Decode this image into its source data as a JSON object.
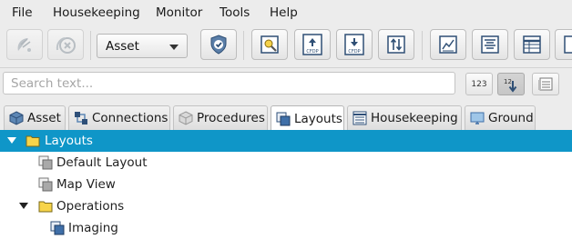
{
  "menubar": {
    "items": [
      "File",
      "Housekeeping",
      "Monitor",
      "Tools",
      "Help"
    ]
  },
  "toolbar": {
    "combo_value": "Asset",
    "buttons": [
      {
        "icon": "satellite-dish-icon",
        "enabled": false
      },
      {
        "icon": "cancel-connection-icon",
        "enabled": false
      },
      {
        "icon": "shield-check-icon",
        "enabled": true
      },
      {
        "icon": "image-search-icon",
        "enabled": true
      },
      {
        "icon": "cfdp-upload-icon",
        "label": "CFDP",
        "enabled": true
      },
      {
        "icon": "cfdp-download-icon",
        "label": "CFDP",
        "enabled": true
      },
      {
        "icon": "transfer-arrows-icon",
        "enabled": true
      },
      {
        "icon": "line-chart-icon",
        "enabled": true
      },
      {
        "icon": "text-document-icon",
        "enabled": true
      },
      {
        "icon": "table-sheet-icon",
        "enabled": true
      },
      {
        "icon": "globe-icon",
        "enabled": true
      }
    ]
  },
  "search": {
    "placeholder": "Search text...",
    "value": ""
  },
  "sort_buttons": [
    {
      "label": "123",
      "icon": "numeric-sort-icon"
    },
    {
      "label": "12",
      "icon": "sort-descending-icon",
      "selected": true
    },
    {
      "icon": "list-view-icon"
    }
  ],
  "tabs": [
    {
      "label": "Asset",
      "icon": "cube-icon"
    },
    {
      "label": "Connections",
      "icon": "connections-icon"
    },
    {
      "label": "Procedures",
      "icon": "procedure-box-icon"
    },
    {
      "label": "Layouts",
      "icon": "layouts-icon",
      "active": true
    },
    {
      "label": "Housekeeping",
      "icon": "housekeeping-icon"
    },
    {
      "label": "Ground",
      "icon": "monitor-icon"
    }
  ],
  "tree": [
    {
      "label": "Layouts",
      "icon": "folder-icon",
      "expanded": true,
      "selected": true
    },
    {
      "label": "Default Layout",
      "icon": "layout-icon"
    },
    {
      "label": "Map View",
      "icon": "layout-icon"
    },
    {
      "label": "Operations",
      "icon": "folder-icon",
      "expanded": true
    },
    {
      "label": "Imaging",
      "icon": "layout-blue-icon"
    }
  ],
  "colors": {
    "selection": "#0f96c8",
    "chrome": "#ececec",
    "folder": "#f7d44a"
  }
}
